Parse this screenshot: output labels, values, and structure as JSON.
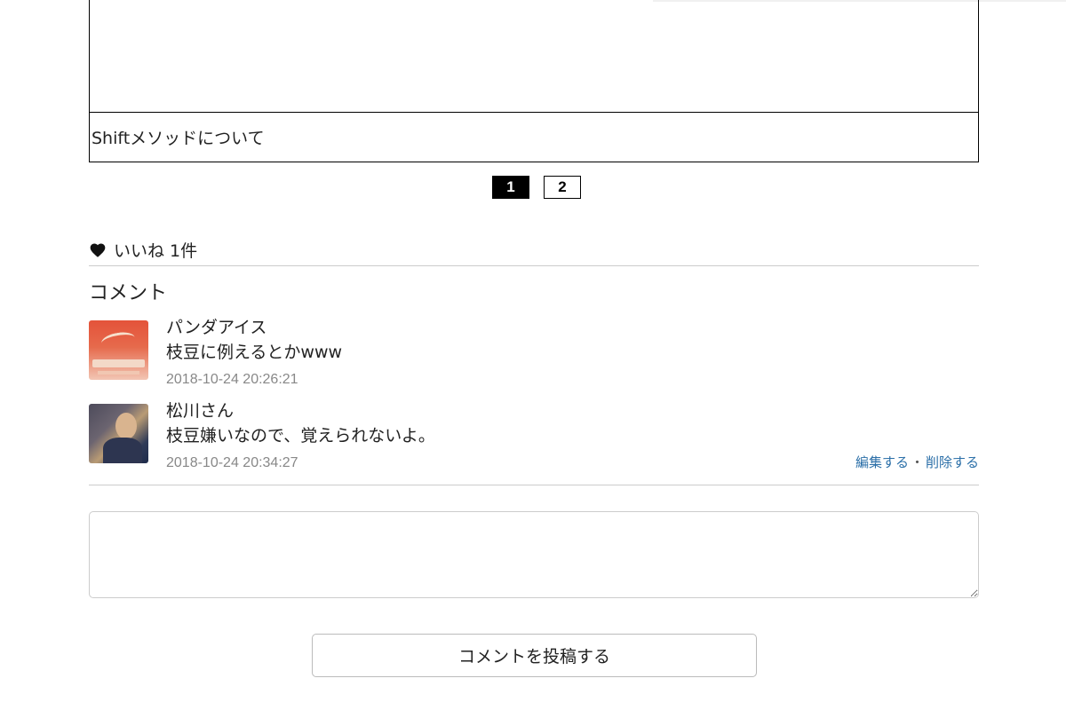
{
  "slide": {
    "caption": "Shiftメソッドについて"
  },
  "pagination": {
    "pages": [
      "1",
      "2"
    ],
    "current": "1"
  },
  "likes": {
    "label": "いいね 1件"
  },
  "comments_section": {
    "heading": "コメント",
    "items": [
      {
        "author": "パンダアイス",
        "text": "枝豆に例えるとかwww",
        "timestamp": "2018-10-24 20:26:21",
        "avatar": "avatar-image"
      },
      {
        "author": "松川さん",
        "text": "枝豆嫌いなので、覚えられないよ。",
        "timestamp": "2018-10-24 20:34:27",
        "avatar": "avatar-image",
        "actions": {
          "edit": "編集する",
          "separator": "・",
          "delete": "削除する"
        }
      }
    ]
  },
  "form": {
    "textarea_value": "",
    "submit_label": "コメントを投稿する"
  },
  "colors": {
    "link": "#2b6fa8",
    "timestamp": "#888888",
    "divider": "#cccccc",
    "active_page_bg": "#000000"
  },
  "icons": {
    "like": "heart-icon",
    "resize": "resize-handle-icon"
  }
}
